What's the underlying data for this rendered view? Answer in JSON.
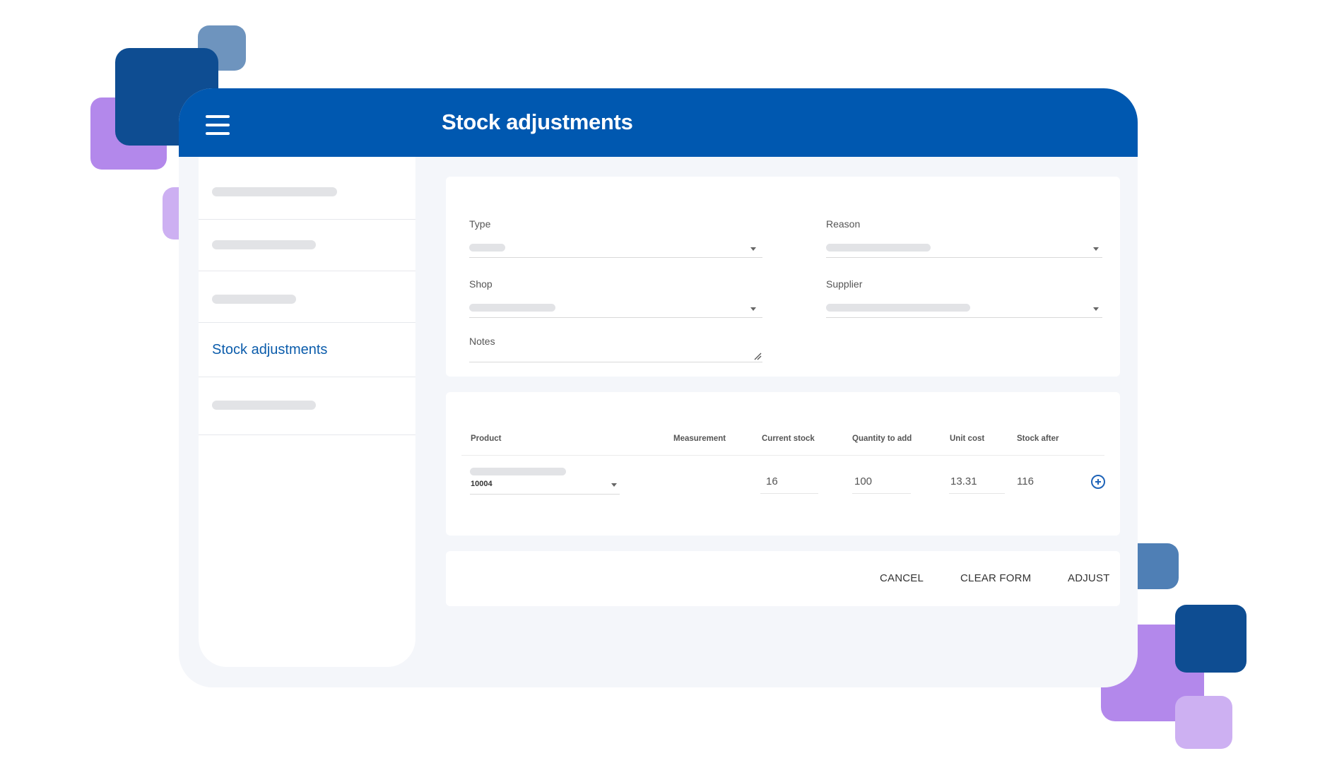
{
  "header": {
    "title": "Stock adjustments"
  },
  "sidebar": {
    "items": [
      {
        "label": ""
      },
      {
        "label": ""
      },
      {
        "label": ""
      },
      {
        "label": "Stock adjustments",
        "active": true
      },
      {
        "label": ""
      }
    ]
  },
  "form": {
    "type_label": "Type",
    "reason_label": "Reason",
    "shop_label": "Shop",
    "supplier_label": "Supplier",
    "notes_label": "Notes"
  },
  "table": {
    "headers": [
      "Product",
      "Measurement",
      "Current stock",
      "Quantity to add",
      "Unit cost",
      "Stock after"
    ],
    "row": {
      "product_code": "10004",
      "measurement": "",
      "current_stock": "16",
      "quantity_to_add": "100",
      "unit_cost": "13.31",
      "stock_after": "116"
    }
  },
  "actions": {
    "cancel": "CANCEL",
    "clear": "CLEAR FORM",
    "adjust": "ADJUST"
  },
  "colors": {
    "primary": "#0058b0",
    "accent_link": "#0b5cab",
    "deco_dark": "#0e4d92",
    "deco_light": "#6e94be",
    "deco_purple": "#b388eb",
    "deco_lavender": "#cdb0f2"
  }
}
